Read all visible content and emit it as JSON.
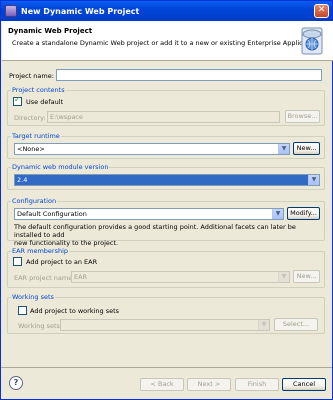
{
  "window": {
    "title": "New Dynamic Web Project",
    "close_glyph": "✕"
  },
  "header": {
    "title": "Dynamic Web Project",
    "description": "Create a standalone Dynamic Web project or add it to a new or existing Enterprise Application."
  },
  "project_name": {
    "label": "Project name:",
    "value": ""
  },
  "project_contents": {
    "title": "Project contents",
    "use_default_label": "Use default",
    "use_default_checked": true,
    "directory_label": "Directory:",
    "directory_value": "E:\\wspace",
    "browse_label": "Browse..."
  },
  "target_runtime": {
    "title": "Target runtime",
    "selected": "<None>",
    "new_label": "New..."
  },
  "module_version": {
    "title": "Dynamic web module version",
    "selected": "2.4"
  },
  "configuration": {
    "title": "Configuration",
    "selected": "Default Configuration",
    "modify_label": "Modify...",
    "description_line1": "The default configuration provides a good starting point. Additional facets can later be installed to add",
    "description_line2": "new functionality to the project."
  },
  "ear_membership": {
    "title": "EAR membership",
    "add_label": "Add project to an EAR",
    "add_checked": false,
    "ear_name_label": "EAR project name:",
    "ear_name_value": "EAR",
    "new_label": "New..."
  },
  "working_sets": {
    "title": "Working sets",
    "add_label": "Add project to working sets",
    "add_checked": false,
    "sets_label": "Working sets:",
    "sets_value": "",
    "select_label": "Select..."
  },
  "footer": {
    "help_glyph": "?",
    "back_label": "< Back",
    "next_label": "Next >",
    "finish_label": "Finish",
    "cancel_label": "Cancel"
  },
  "icons": {
    "help": "help-icon",
    "combo_arrow": "chevron-down-icon",
    "banner": "web-project-wizard-banner-icon"
  }
}
